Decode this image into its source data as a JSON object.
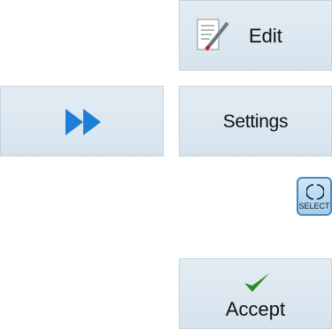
{
  "softkeys": {
    "edit": {
      "label": "Edit",
      "icon": "edit-pencil-icon"
    },
    "forward": {
      "icon": "double-chevron-right-icon"
    },
    "settings": {
      "label": "Settings"
    },
    "accept": {
      "label": "Accept",
      "icon": "checkmark-icon"
    }
  },
  "select_key": {
    "label": "SELECT",
    "icon": "circle-arrows-icon"
  },
  "colors": {
    "softkey_bg": "#d9e5ef",
    "forward_arrow": "#1e7fd6",
    "checkmark": "#2e8b1f",
    "select_border": "#4d88b8"
  }
}
